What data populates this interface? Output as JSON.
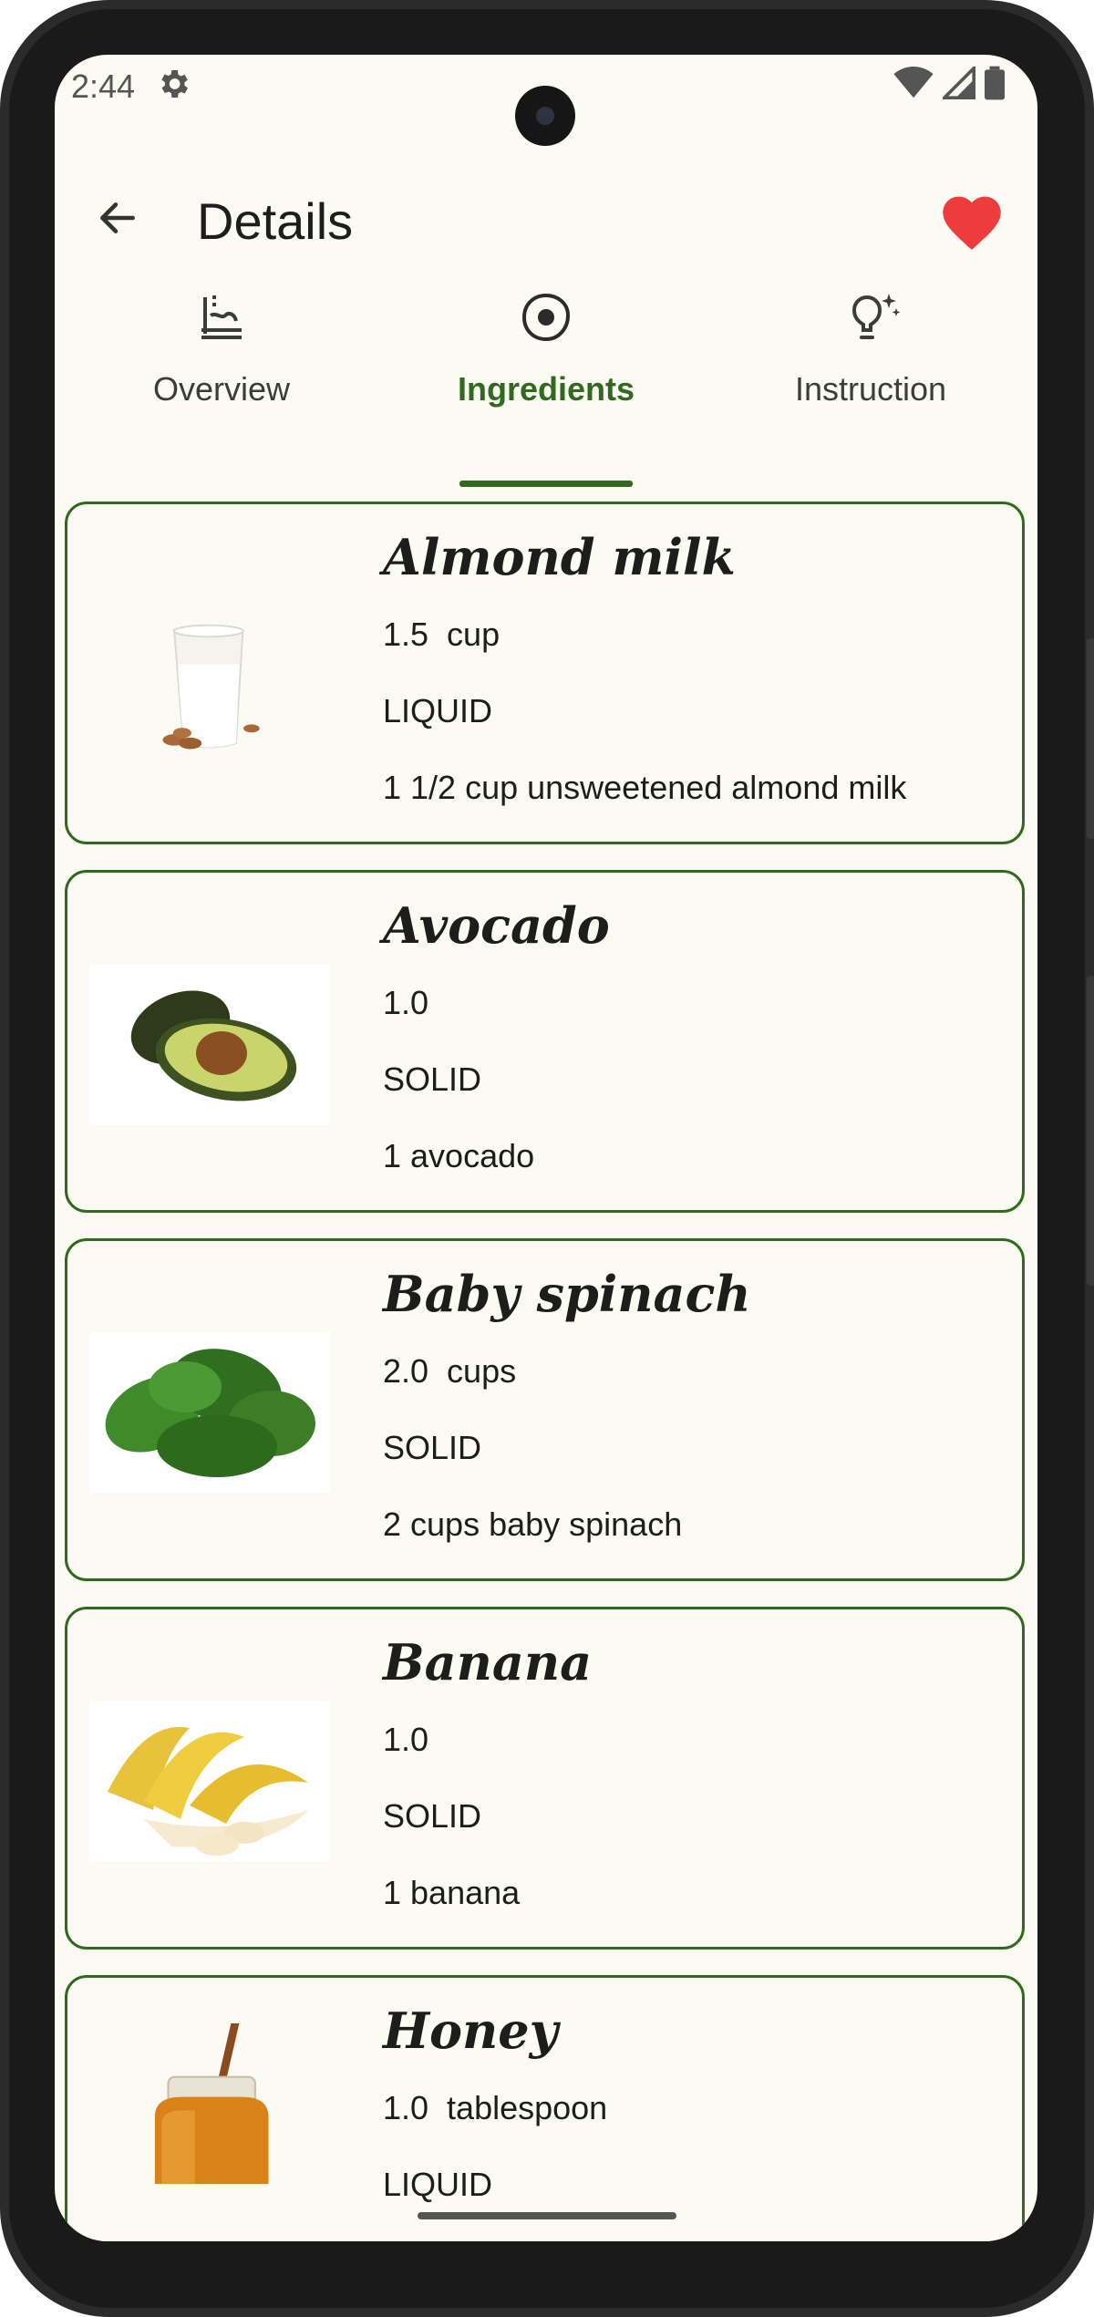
{
  "status_bar": {
    "time": "2:44"
  },
  "header": {
    "title": "Details"
  },
  "tabs": [
    {
      "label": "Overview",
      "icon": "recipe-icon",
      "active": false
    },
    {
      "label": "Ingredients",
      "icon": "egg-icon",
      "active": true
    },
    {
      "label": "Instruction",
      "icon": "lightbulb-icon",
      "active": false
    }
  ],
  "colors": {
    "accent": "#2f6a1e",
    "favorite": "#ee3b3b",
    "background": "#fcfbf3"
  },
  "ingredients": [
    {
      "name": "Almond milk",
      "quantity": "1.5  cup",
      "type": "LIQUID",
      "description": "1 1/2 cup unsweetened almond milk",
      "image": "almond-milk-glass"
    },
    {
      "name": "Avocado",
      "quantity": "1.0",
      "type": "SOLID",
      "description": "1 avocado",
      "image": "avocado"
    },
    {
      "name": "Baby spinach",
      "quantity": "2.0  cups",
      "type": "SOLID",
      "description": "2 cups baby spinach",
      "image": "spinach"
    },
    {
      "name": "Banana",
      "quantity": "1.0",
      "type": "SOLID",
      "description": "1 banana",
      "image": "bananas"
    },
    {
      "name": "Honey",
      "quantity": "1.0  tablespoon",
      "type": "LIQUID",
      "description": "",
      "image": "honey-jar"
    }
  ]
}
